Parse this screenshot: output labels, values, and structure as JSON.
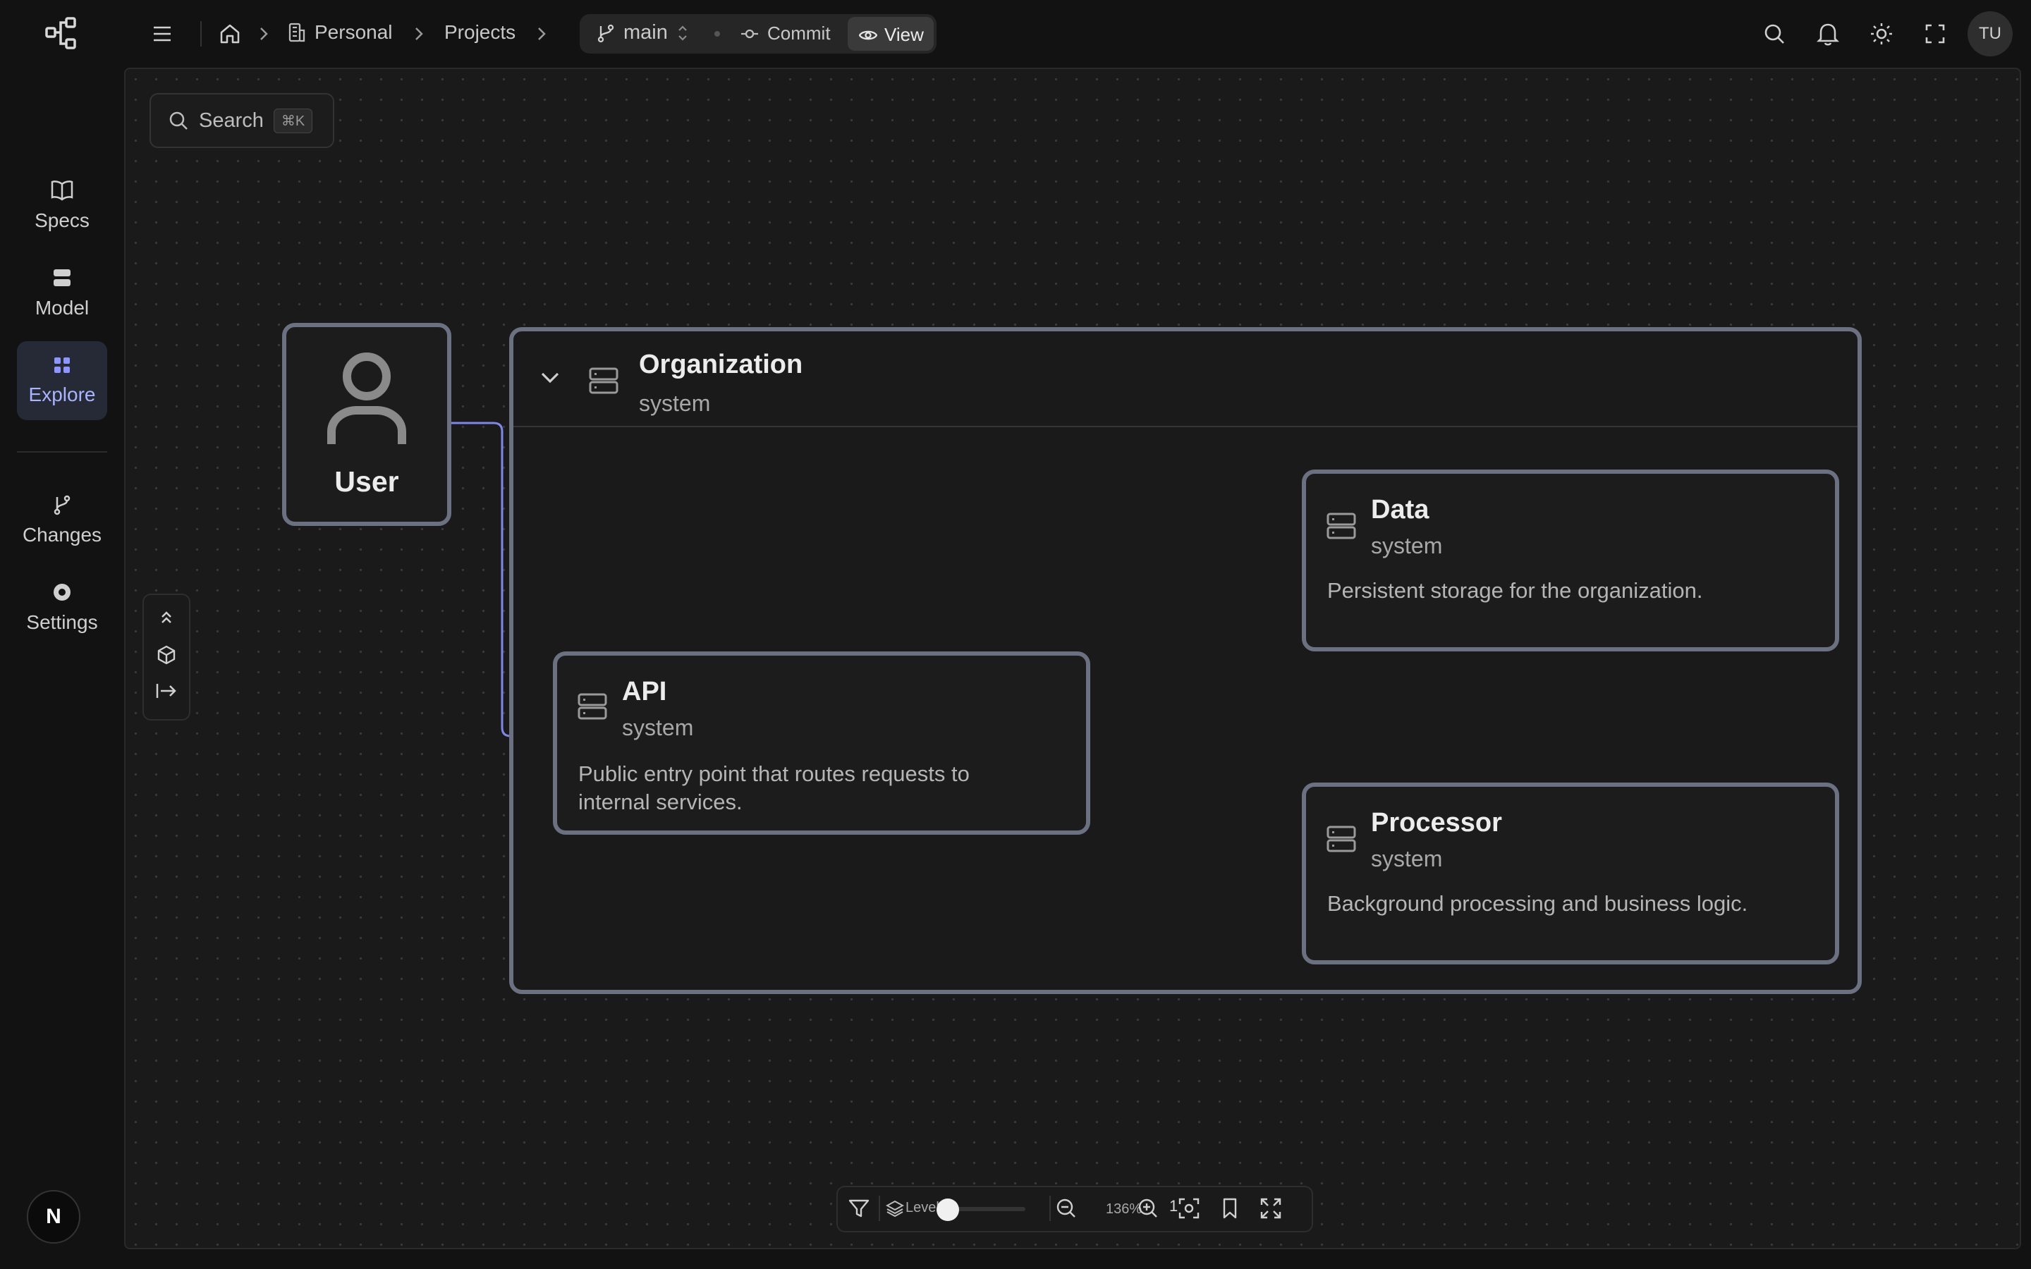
{
  "sidebar": {
    "items": [
      {
        "label": "Specs",
        "icon": "book-icon"
      },
      {
        "label": "Model",
        "icon": "model-icon"
      },
      {
        "label": "Explore",
        "icon": "grid-icon",
        "active": true
      },
      {
        "label": "Changes",
        "icon": "git-branch-icon"
      },
      {
        "label": "Settings",
        "icon": "gear-icon"
      }
    ],
    "footer_badge": "N"
  },
  "topbar": {
    "breadcrumb": [
      "Personal",
      "Projects"
    ],
    "branch": "main",
    "commit_label": "Commit",
    "view_label": "View",
    "user_initials": "TU"
  },
  "canvas": {
    "search": {
      "label": "Search",
      "shortcut": "⌘K"
    },
    "nodes": {
      "user": {
        "title": "User"
      },
      "org": {
        "title": "Organization",
        "kind": "system"
      },
      "api": {
        "title": "API",
        "kind": "system",
        "desc_line1": "Public entry point that routes requests to",
        "desc_line2": "internal services."
      },
      "data": {
        "title": "Data",
        "kind": "system",
        "desc": "Persistent storage for the organization."
      },
      "processor": {
        "title": "Processor",
        "kind": "system",
        "desc": "Background processing and business logic."
      }
    },
    "toolbar": {
      "level_label": "Level",
      "level_value": "1",
      "zoom": "136%"
    }
  },
  "colors": {
    "accent": "#8d96ff",
    "node_border": "#6b7180",
    "background": "#1a1a1a"
  }
}
